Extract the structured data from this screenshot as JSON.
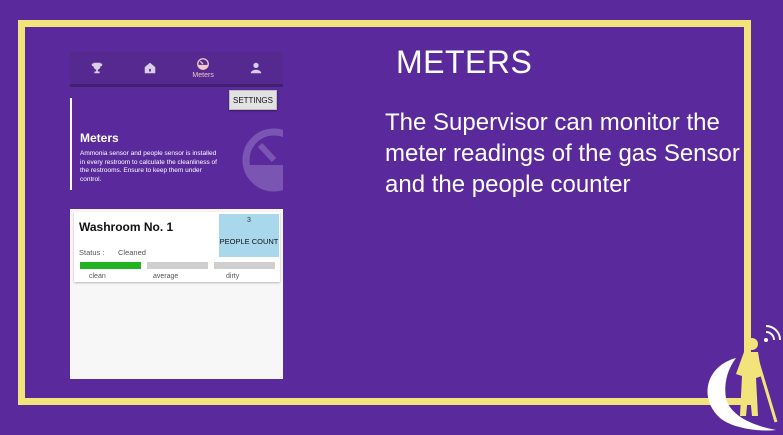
{
  "slide": {
    "title": "METERS",
    "description": "The Supervisor can monitor the meter readings of the gas Sensor and the people counter"
  },
  "phone": {
    "nav": {
      "items": [
        {
          "icon": "trophy-icon",
          "label": ""
        },
        {
          "icon": "home-icon",
          "label": ""
        },
        {
          "icon": "meter-icon",
          "label": "Meters"
        },
        {
          "icon": "person-icon",
          "label": ""
        }
      ]
    },
    "settings_label": "SETTINGS",
    "info": {
      "title": "Meters",
      "text": "Ammonia sensor and people sensor is installed in every restroom to calculate the cleanliness of the restrooms. Ensure to keep them under control."
    },
    "card": {
      "title": "Washroom No. 1",
      "status_label": "Status :",
      "status_value": "Cleaned",
      "people_count_value": "3",
      "people_count_label": "PEOPLE COUNT",
      "meter": {
        "levels": [
          "clean",
          "average",
          "dirty"
        ],
        "active_level": "clean",
        "active_color": "#22b322",
        "inactive_color": "#cfcfcf"
      }
    }
  },
  "colors": {
    "background": "#5a2a9c",
    "frame": "#f2e47a"
  }
}
